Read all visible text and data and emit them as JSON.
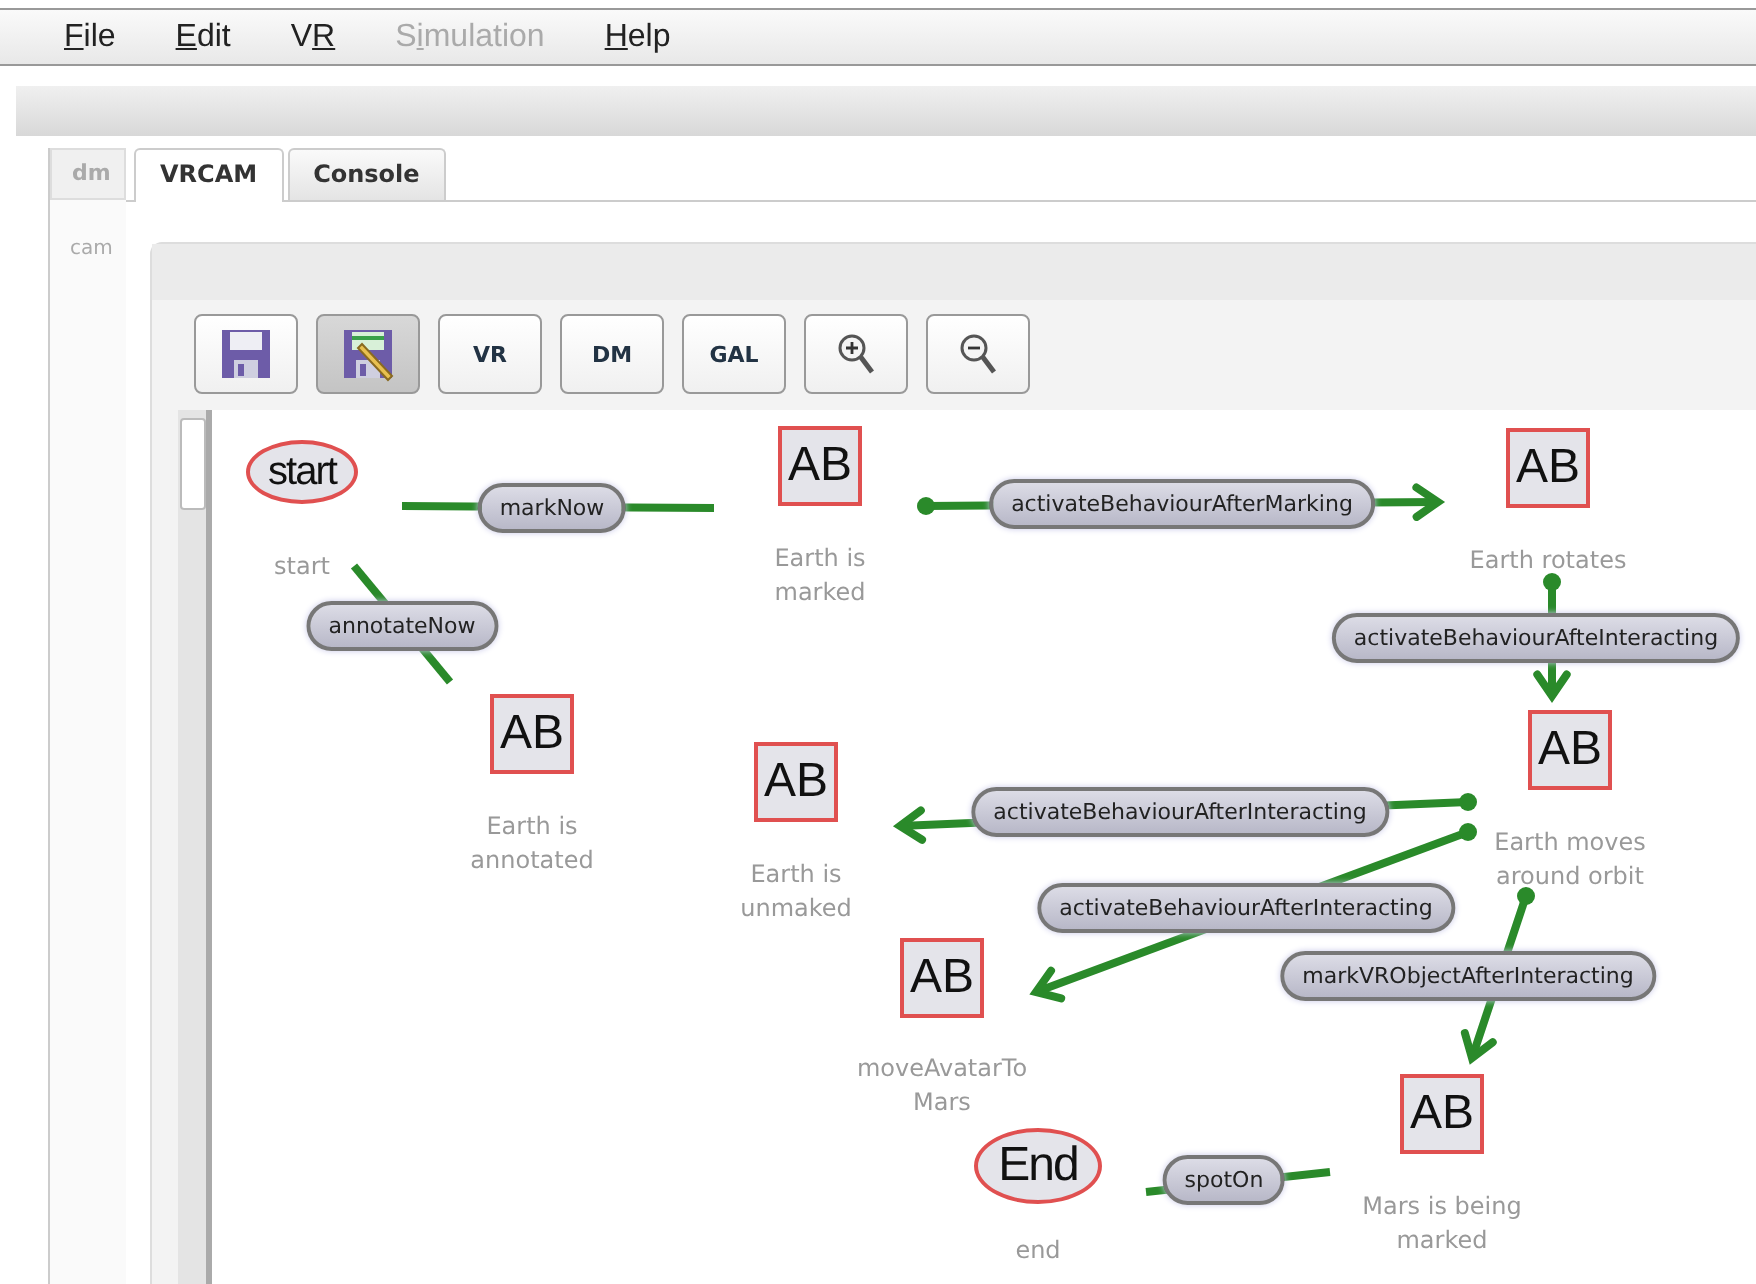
{
  "menu": [
    {
      "key": "F",
      "after": "ile",
      "disabled": false
    },
    {
      "key": "E",
      "after": "dit",
      "disabled": false
    },
    {
      "before": "V",
      "key": "R",
      "disabled": false
    },
    {
      "before": "S",
      "key": "i",
      "after": "mulation",
      "disabled": true
    },
    {
      "key": "H",
      "after": "elp",
      "disabled": false
    }
  ],
  "left_panel": {
    "tab": "dm",
    "item": "cam"
  },
  "tabs": [
    {
      "label": "VRCAM",
      "selected": true
    },
    {
      "label": "Console",
      "selected": false
    }
  ],
  "toolbar": [
    {
      "kind": "save",
      "pressed": false
    },
    {
      "kind": "save-edit",
      "pressed": true
    },
    {
      "kind": "text",
      "label": "VR",
      "pressed": false
    },
    {
      "kind": "text",
      "label": "DM",
      "pressed": false
    },
    {
      "kind": "text",
      "label": "GAL",
      "pressed": false
    },
    {
      "kind": "zoom-in",
      "pressed": false
    },
    {
      "kind": "zoom-out",
      "pressed": false
    }
  ],
  "diagram": {
    "nodes": [
      {
        "kind": "initial",
        "text": "start",
        "caption": "start"
      },
      {
        "kind": "state",
        "text": "AB",
        "caption": "Earth is\nmarked"
      },
      {
        "kind": "state",
        "text": "AB",
        "caption": "Earth rotates"
      },
      {
        "kind": "state",
        "text": "AB",
        "caption": "Earth is\nannotated"
      },
      {
        "kind": "state",
        "text": "AB",
        "caption": "Earth moves\naround orbit"
      },
      {
        "kind": "state",
        "text": "AB",
        "caption": "Earth is\nunmaked"
      },
      {
        "kind": "state",
        "text": "AB",
        "caption": "moveAvatarTo\nMars"
      },
      {
        "kind": "final",
        "text": "End",
        "caption": "end"
      },
      {
        "kind": "state",
        "text": "AB",
        "caption": "Mars is being\nmarked"
      }
    ],
    "transitions": [
      {
        "text": "markNow",
        "start_dot": false,
        "arrow_head": false
      },
      {
        "text": "annotateNow",
        "start_dot": false,
        "arrow_head": false
      },
      {
        "text": "activateBehaviourAfterMarking",
        "start_dot": true,
        "arrow_head": true
      },
      {
        "text": "activateBehaviourAfteInteracting",
        "start_dot": true,
        "arrow_head": true
      },
      {
        "text": "activateBehaviourAfterInteracting",
        "start_dot": true,
        "arrow_head": true
      },
      {
        "text": "activateBehaviourAfterInteracting",
        "start_dot": true,
        "arrow_head": true
      },
      {
        "text": "markVRObjectAfterInteracting",
        "start_dot": true,
        "arrow_head": true
      },
      {
        "text": "spotOn",
        "start_dot": false,
        "arrow_head": false
      }
    ]
  }
}
